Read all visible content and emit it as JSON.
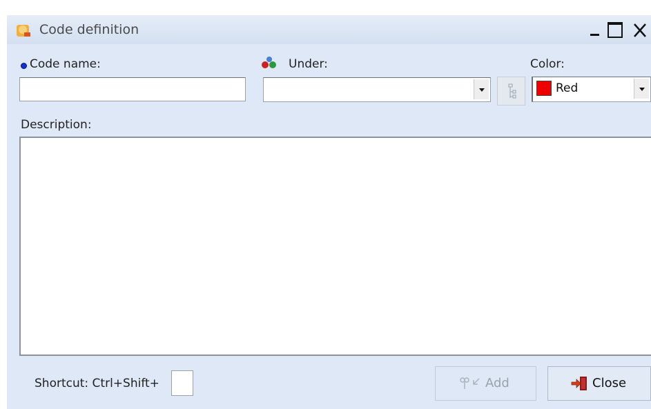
{
  "window": {
    "title": "Code definition"
  },
  "form": {
    "code_name_label": "Code name:",
    "code_name_value": "",
    "under_label": "Under:",
    "under_value": "",
    "color_label": "Color:",
    "color_value": "Red",
    "color_swatch": "#ee0000",
    "description_label": "Description:",
    "description_value": "",
    "shortcut_label": "Shortcut: Ctrl+Shift+",
    "shortcut_value": ""
  },
  "buttons": {
    "add_label": "Add",
    "close_label": "Close"
  },
  "icons": {
    "app": "code-app-icon",
    "under": "code-tree-colored-balls-icon",
    "tree_button": "hierarchy-icon",
    "add": "add-code-icon",
    "close": "exit-door-icon"
  },
  "colors": {
    "accent_bullet": "#1030d8",
    "dialog_background": "#dfe8f6",
    "disabled_text": "#9aa2ac"
  }
}
